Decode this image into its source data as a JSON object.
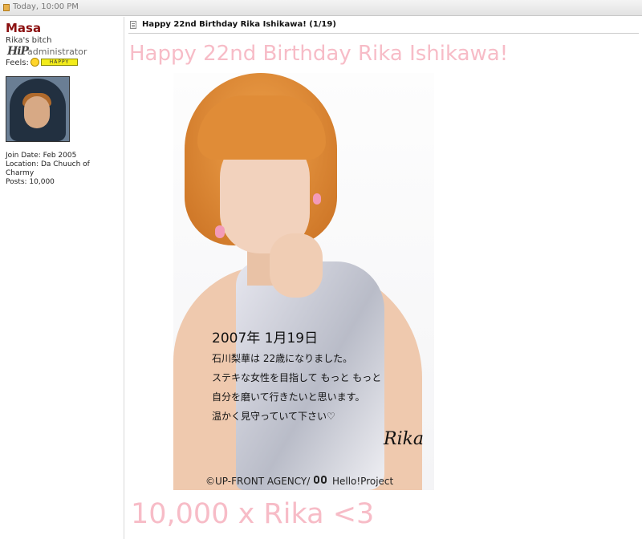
{
  "top_bar": {
    "date": "Today, 10:00 PM"
  },
  "user": {
    "name": "Masa",
    "title": "Rika's bitch",
    "rank_logo": "HiP",
    "rank": "administrator",
    "feels_label": "Feels:",
    "mood": "HAPPY",
    "join_date": "Join Date: Feb 2005",
    "location": "Location: Da Chuuch of Charmy",
    "posts": "Posts: 10,000"
  },
  "post": {
    "title": "Happy 22nd Birthday Rika Ishikawa! (1/19)",
    "headline": "Happy 22nd Birthday Rika Ishikawa!",
    "image_message": [
      "2007年 1月19日",
      "石川梨華は 22歳になりました。",
      "ステキな女性を目指して もっと もっと",
      "自分を磨いて行きたいと思います。",
      "温かく見守っていて下さい♡"
    ],
    "signature": "Rika",
    "copyright": "©UP-FRONT AGENCY/",
    "copyright_project": "Hello!Project",
    "footer": "10,000 x Rika <3"
  }
}
